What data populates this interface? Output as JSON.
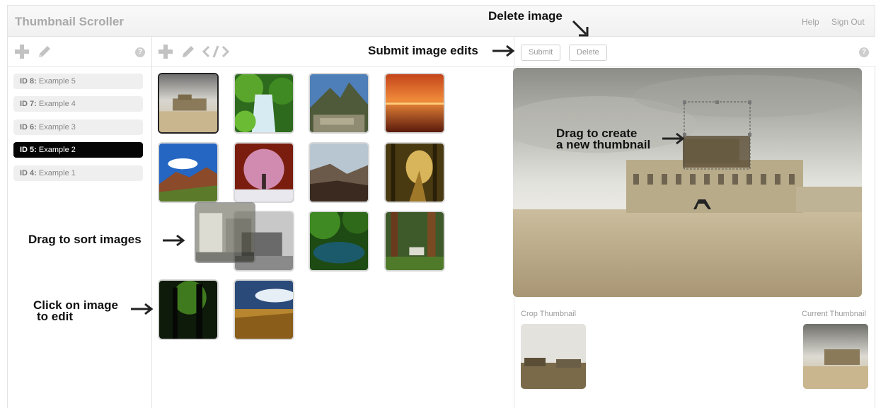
{
  "app": {
    "title": "Thumbnail Scroller"
  },
  "nav": {
    "help": "Help",
    "sign_out": "Sign Out"
  },
  "toolbar": {
    "submit": "Submit",
    "delete": "Delete",
    "help_icon": "?"
  },
  "list": {
    "items": [
      {
        "id": "ID 8:",
        "name": "Example 5",
        "active": false
      },
      {
        "id": "ID 7:",
        "name": "Example 4",
        "active": false
      },
      {
        "id": "ID 6:",
        "name": "Example 3",
        "active": false
      },
      {
        "id": "ID 5:",
        "name": "Example 2",
        "active": true
      },
      {
        "id": "ID 4:",
        "name": "Example 1",
        "active": false
      }
    ]
  },
  "gallery": {
    "images": [
      {
        "subject": "palace-panorama",
        "selected": true
      },
      {
        "subject": "waterfall-forest"
      },
      {
        "subject": "mountain-ruins"
      },
      {
        "subject": "red-sunset-sea"
      },
      {
        "subject": "blue-sky-mountains"
      },
      {
        "subject": "pink-blossom-tree"
      },
      {
        "subject": "mountain-valley"
      },
      {
        "subject": "forest-path"
      },
      {
        "subject": "castle-ruins-ghost"
      },
      {
        "subject": "castle-lake"
      },
      {
        "subject": "green-lagoon"
      },
      {
        "subject": "redwood-forest"
      },
      {
        "subject": "dark-green-forest"
      },
      {
        "subject": "wheat-field"
      }
    ]
  },
  "editor": {
    "crop_label": "Crop Thumbnail",
    "current_label": "Current Thumbnail"
  },
  "annotations": {
    "delete_image": "Delete image",
    "submit_edits": "Submit image edits",
    "drag_thumbnail_line1": "Drag to create",
    "drag_thumbnail_line2": "a new thumbnail",
    "drag_sort": "Drag to sort images",
    "click_edit_line1": "Click on image",
    "click_edit_line2": "to edit"
  },
  "icons": [
    "plus-icon",
    "pencil-icon",
    "code-icon",
    "help-icon",
    "arrow-right-icon",
    "arrow-down-right-icon"
  ],
  "colors": {
    "active_item": "#050505",
    "muted_text": "#a9a9a9",
    "border": "#e3e3e3"
  }
}
